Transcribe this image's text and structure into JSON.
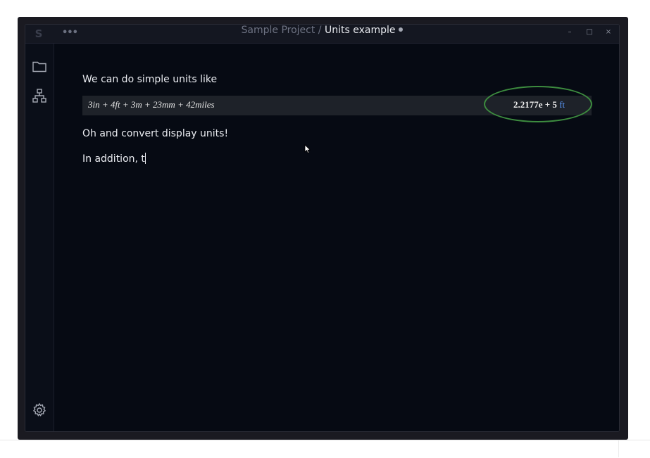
{
  "titlebar": {
    "project": "Sample Project",
    "separator": " / ",
    "document": "Units example",
    "more_label": "•••",
    "minimize": "–",
    "maximize": "□",
    "close": "×",
    "logo": "S"
  },
  "sidebar": {
    "items": [
      {
        "icon": "folder-icon"
      },
      {
        "icon": "sitemap-icon"
      },
      {
        "icon": "gear-icon"
      }
    ]
  },
  "document": {
    "para1": "We can do simple units like",
    "math": {
      "expression": "3in + 4ft + 3m + 23mm + 42miles",
      "result_value": "2.2177e + 5",
      "result_unit": "ft"
    },
    "para2": "Oh and convert display units!",
    "para3": "In addition, t"
  },
  "colors": {
    "accent_unit": "#5b9bff",
    "highlight_ellipse": "#3d8c3f",
    "background": "#060a13"
  }
}
